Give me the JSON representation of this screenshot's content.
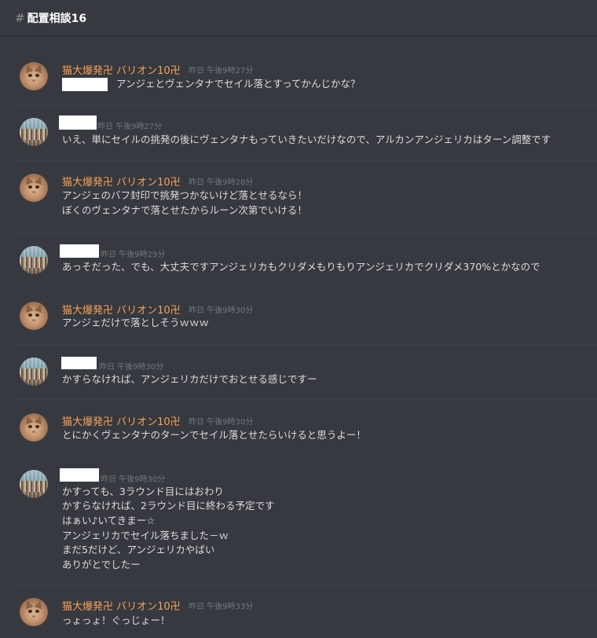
{
  "header": {
    "hash_symbol": "#",
    "channel_name": "配置相談16"
  },
  "messages": [
    {
      "author": "猫大爆発卍 バリオン10卍",
      "author_redacted": false,
      "timestamp": "昨日 午後9時27分",
      "lines": [
        "アンジェとヴェンタナでセイル落とすってかんじかな？"
      ],
      "inline_mention_redacted": true,
      "avatar": "cat-avatar"
    },
    {
      "author": "",
      "author_redacted": true,
      "timestamp": "昨日 午後9時27分",
      "lines": [
        "いえ、単にセイルの挑発の後にヴェンタナもっていきたいだけなので、アルカンアンジェリカはターン調整です"
      ],
      "avatar": "crowd-avatar"
    },
    {
      "author": "猫大爆発卍 バリオン10卍",
      "author_redacted": false,
      "timestamp": "昨日 午後9時28分",
      "lines": [
        "アンジェのバフ封印で挑発つかないけど落とせるなら！",
        "ぼくのヴェンタナで落とせたからルーン次第でいける！"
      ],
      "avatar": "cat-avatar"
    },
    {
      "author": "",
      "author_redacted": true,
      "timestamp": "昨日 午後9時29分",
      "lines": [
        "あっそだった、でも、大丈夫ですアンジェリカもクリダメもりもりアンジェリカでクリダメ370%とかなので"
      ],
      "avatar": "crowd-avatar"
    },
    {
      "author": "猫大爆発卍 バリオン10卍",
      "author_redacted": false,
      "timestamp": "昨日 午後9時30分",
      "lines": [
        "アンジェだけで落としそうｗｗｗ"
      ],
      "avatar": "cat-avatar"
    },
    {
      "author": "",
      "author_redacted": true,
      "timestamp": "昨日 午後9時30分",
      "lines": [
        "かすらなければ、アンジェリカだけでおとせる感じですー"
      ],
      "avatar": "crowd-avatar"
    },
    {
      "author": "猫大爆発卍 バリオン10卍",
      "author_redacted": false,
      "timestamp": "昨日 午後9時30分",
      "lines": [
        "とにかくヴェンタナのターンでセイル落とせたらいけると思うよー！"
      ],
      "avatar": "cat-avatar"
    },
    {
      "author": "",
      "author_redacted": true,
      "timestamp": "昨日 午後9時30分",
      "lines": [
        "かすっても、3ラウンド目にはおわり",
        "かすらなければ、2ラウンド目に終わる予定です",
        "はぁい♪いてきまー☆",
        "アンジェリカでセイル落ちました－ｗ",
        "まだ5だけど、アンジェリカやばい",
        "ありがとでしたー"
      ],
      "avatar": "crowd-avatar"
    },
    {
      "author": "猫大爆発卍 バリオン10卍",
      "author_redacted": false,
      "timestamp": "昨日 午後9時33分",
      "lines": [
        "っょっょ！ぐっじょー！"
      ],
      "avatar": "cat-avatar"
    }
  ],
  "colors": {
    "background": "#36393f",
    "username": "#f7a25b",
    "message_text": "#dcddde",
    "timestamp": "#72767d",
    "header_text": "#ffffff"
  }
}
